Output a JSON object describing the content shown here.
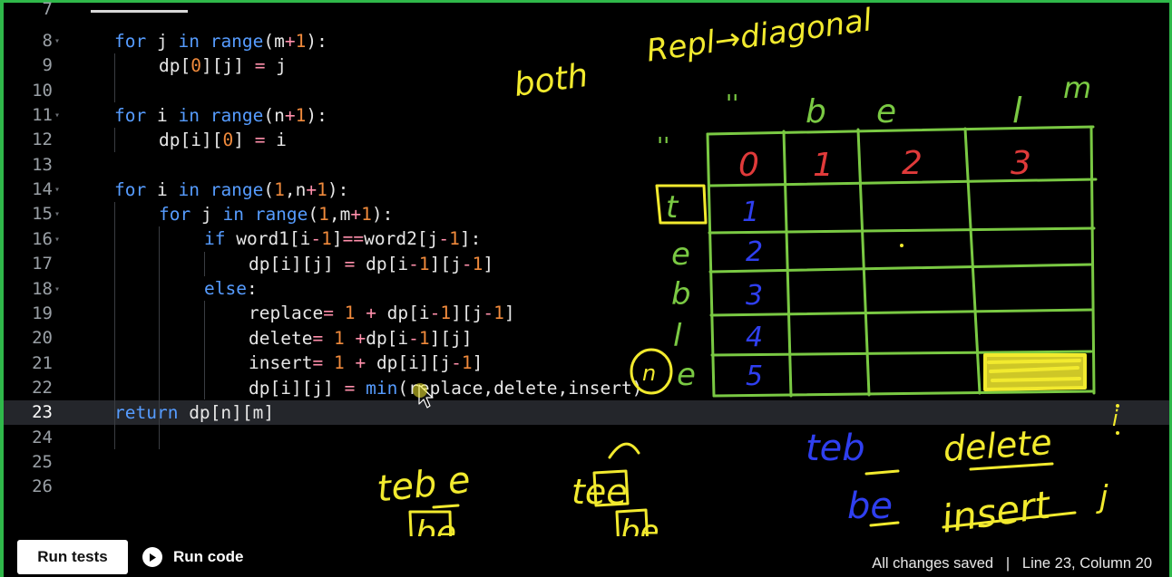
{
  "editor": {
    "partial_top_line": "7",
    "lines": [
      {
        "num": "8",
        "fold": true
      },
      {
        "num": "9",
        "fold": false
      },
      {
        "num": "10",
        "fold": false
      },
      {
        "num": "11",
        "fold": true
      },
      {
        "num": "12",
        "fold": false
      },
      {
        "num": "13",
        "fold": false
      },
      {
        "num": "14",
        "fold": true
      },
      {
        "num": "15",
        "fold": true
      },
      {
        "num": "16",
        "fold": true
      },
      {
        "num": "17",
        "fold": false
      },
      {
        "num": "18",
        "fold": true
      },
      {
        "num": "19",
        "fold": false
      },
      {
        "num": "20",
        "fold": false
      },
      {
        "num": "21",
        "fold": false
      },
      {
        "num": "22",
        "fold": false
      },
      {
        "num": "23",
        "fold": false
      },
      {
        "num": "24",
        "fold": false
      },
      {
        "num": "25",
        "fold": false
      },
      {
        "num": "26",
        "fold": false
      }
    ],
    "active_line": "23"
  },
  "code": {
    "l8": {
      "a": "for",
      "b": " j ",
      "c": "in",
      "d": " ",
      "e": "range",
      "f": "(m",
      "g": "+",
      "h": "1",
      "i": "):"
    },
    "l9": {
      "a": "dp[",
      "b": "0",
      "c": "][j] ",
      "d": "=",
      "e": " j"
    },
    "l11": {
      "a": "for",
      "b": " i ",
      "c": "in",
      "d": " ",
      "e": "range",
      "f": "(n",
      "g": "+",
      "h": "1",
      "i": "):"
    },
    "l12": {
      "a": "dp[i][",
      "b": "0",
      "c": "] ",
      "d": "=",
      "e": " i"
    },
    "l14": {
      "a": "for",
      "b": " i ",
      "c": "in",
      "d": " ",
      "e": "range",
      "f": "(",
      "g": "1",
      "h": ",n",
      "i": "+",
      "j": "1",
      "k": "):"
    },
    "l15": {
      "a": "for",
      "b": " j ",
      "c": "in",
      "d": " ",
      "e": "range",
      "f": "(",
      "g": "1",
      "h": ",m",
      "i": "+",
      "j": "1",
      "k": "):"
    },
    "l16": {
      "a": "if",
      "b": " word1[i",
      "c": "-",
      "d": "1",
      "e": "]",
      "f": "==",
      "g": "word2[j",
      "h": "-",
      "i": "1",
      "j": "]:"
    },
    "l17": {
      "a": "dp[i][j] ",
      "b": "=",
      "c": " dp[i",
      "d": "-",
      "e": "1",
      "f": "][j",
      "g": "-",
      "h": "1",
      "i": "]"
    },
    "l18": {
      "a": "else",
      "b": ":"
    },
    "l19": {
      "a": "replace",
      "b": "=",
      "c": " ",
      "d": "1",
      "e": " ",
      "f": "+",
      "g": " dp[i",
      "h": "-",
      "i": "1",
      "j": "][j",
      "k": "-",
      "l": "1",
      "m": "]"
    },
    "l20": {
      "a": "delete",
      "b": "=",
      "c": " ",
      "d": "1",
      "e": " ",
      "f": "+",
      "g": "dp[i",
      "h": "-",
      "i": "1",
      "j": "][j]"
    },
    "l21": {
      "a": "insert",
      "b": "=",
      "c": " ",
      "d": "1",
      "e": " ",
      "f": "+",
      "g": " dp[i][j",
      "h": "-",
      "i": "1",
      "j": "]"
    },
    "l22": {
      "a": "dp[i][j] ",
      "b": "=",
      "c": " ",
      "d": "min",
      "e": "(replace,delete,insert)"
    },
    "l23": {
      "a": "return",
      "b": " dp[n][m]"
    }
  },
  "annotations": {
    "top_right": "Repl→diagonal",
    "both": "both",
    "col_headers": [
      "''",
      "b",
      "e",
      "l",
      "m"
    ],
    "row_headers": [
      "''",
      "t",
      "e",
      "b",
      "l",
      "e"
    ],
    "header_row_values": [
      "0",
      "1",
      "2",
      "3"
    ],
    "first_col_values": [
      "1",
      "2",
      "3",
      "4",
      "5"
    ],
    "n_mark": "n",
    "i_mark": "i",
    "j_mark": "j",
    "left_note_top": "teb e",
    "left_note_bottom": "be",
    "mid_note_top": "tee",
    "mid_note_bottom": "be",
    "right_note_top": "teb",
    "right_note_bottom": "be",
    "delete_word": "delete",
    "insert_word": "insert",
    "colors": {
      "yellow": "#f2ea2e",
      "green": "#7ac943",
      "red": "#e03a3a",
      "blue": "#2f3ff0"
    }
  },
  "bottom": {
    "run_tests": "Run tests",
    "run_code": "Run code",
    "status": "All changes saved   |   Line 23, Column 20"
  }
}
